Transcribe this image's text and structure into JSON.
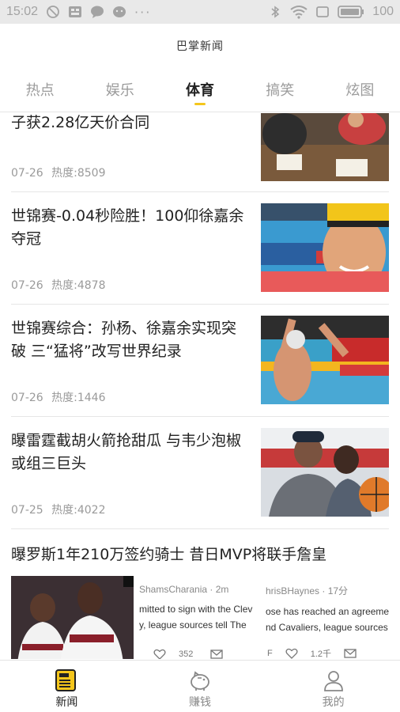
{
  "status_bar": {
    "time": "15:02",
    "battery": "100"
  },
  "app": {
    "title": "巴掌新闻"
  },
  "tabs": [
    {
      "label": "热点"
    },
    {
      "label": "娱乐"
    },
    {
      "label": "体育",
      "active": true
    },
    {
      "label": "搞笑"
    },
    {
      "label": "炫图"
    }
  ],
  "news": [
    {
      "title": "子获2.28亿天价合同",
      "date": "07-26",
      "heat": "热度:8509"
    },
    {
      "title": "世锦赛-0.04秒险胜！100仰徐嘉余夺冠",
      "date": "07-26",
      "heat": "热度:4878"
    },
    {
      "title": "世锦赛综合：孙杨、徐嘉余实现突破 三“猛将”改写世界纪录",
      "date": "07-26",
      "heat": "热度:1446"
    },
    {
      "title": "曝雷霆截胡火箭抢甜瓜 与韦少泡椒或组三巨头",
      "date": "07-25",
      "heat": "热度:4022"
    }
  ],
  "big_item": {
    "title": "曝罗斯1年210万签约骑士 昔日MVP将联手詹皇",
    "tweet1": {
      "handle": "ShamsCharania · 2m",
      "line1": "mitted to sign with the Clev",
      "line2": "y, league sources tell The",
      "likes": "352"
    },
    "tweet2": {
      "handle": "hrisBHaynes · 17分",
      "line1": "ose has reached an agreeme",
      "line2": "nd Cavaliers, league sources",
      "prefix": "F",
      "likes": "1.2千"
    }
  },
  "bottom_nav": [
    {
      "label": "新闻",
      "icon": "news-icon",
      "active": true
    },
    {
      "label": "赚钱",
      "icon": "piggy-bank-icon"
    },
    {
      "label": "我的",
      "icon": "person-icon"
    }
  ],
  "colors": {
    "accent": "#f4c61c",
    "status_bar": "#e9e9e9",
    "muted_text": "#9a9a9a"
  }
}
